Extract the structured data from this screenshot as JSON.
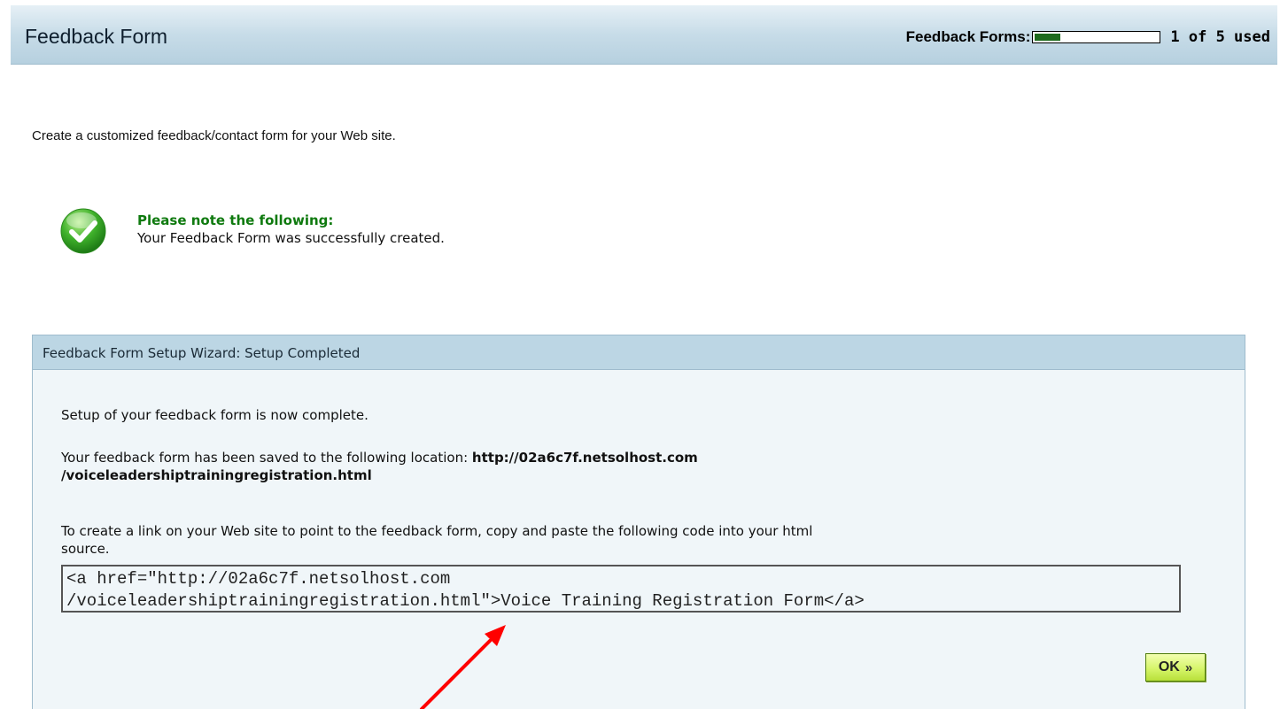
{
  "header": {
    "title": "Feedback Form",
    "quota_label": "Feedback Forms:",
    "quota_used_text": "1 of 5 used",
    "quota_fraction": 0.2
  },
  "intro": "Create a customized feedback/contact form for your Web site.",
  "note": {
    "icon": "checkmark-icon",
    "heading": "Please note the following:",
    "message": "Your Feedback Form was successfully created."
  },
  "wizard": {
    "title": "Feedback Form Setup Wizard: Setup Completed",
    "complete_text": "Setup of your feedback form is now complete.",
    "saved_prefix": "Your feedback form has been saved to the following location:",
    "saved_url_line1": "http://02a6c7f.netsolhost.com",
    "saved_url_line2": "/voiceleadershiptrainingregistration.html",
    "link_instructions_line1": "To create a link on your Web site to point to the feedback form, copy and paste the following code into your html",
    "link_instructions_line2": "source.",
    "code_line1": "<a href=\"http://02a6c7f.netsolhost.com",
    "code_line2": "/voiceleadershiptrainingregistration.html\">Voice Training Registration Form</a>",
    "ok_label": "OK",
    "ok_icon": "double-chevron-right-icon"
  },
  "colors": {
    "header_bg": "#c7dce8",
    "note_heading": "#0f7a0f",
    "ok_button": "#d6f56a",
    "annotation_arrow": "#ff0000"
  }
}
